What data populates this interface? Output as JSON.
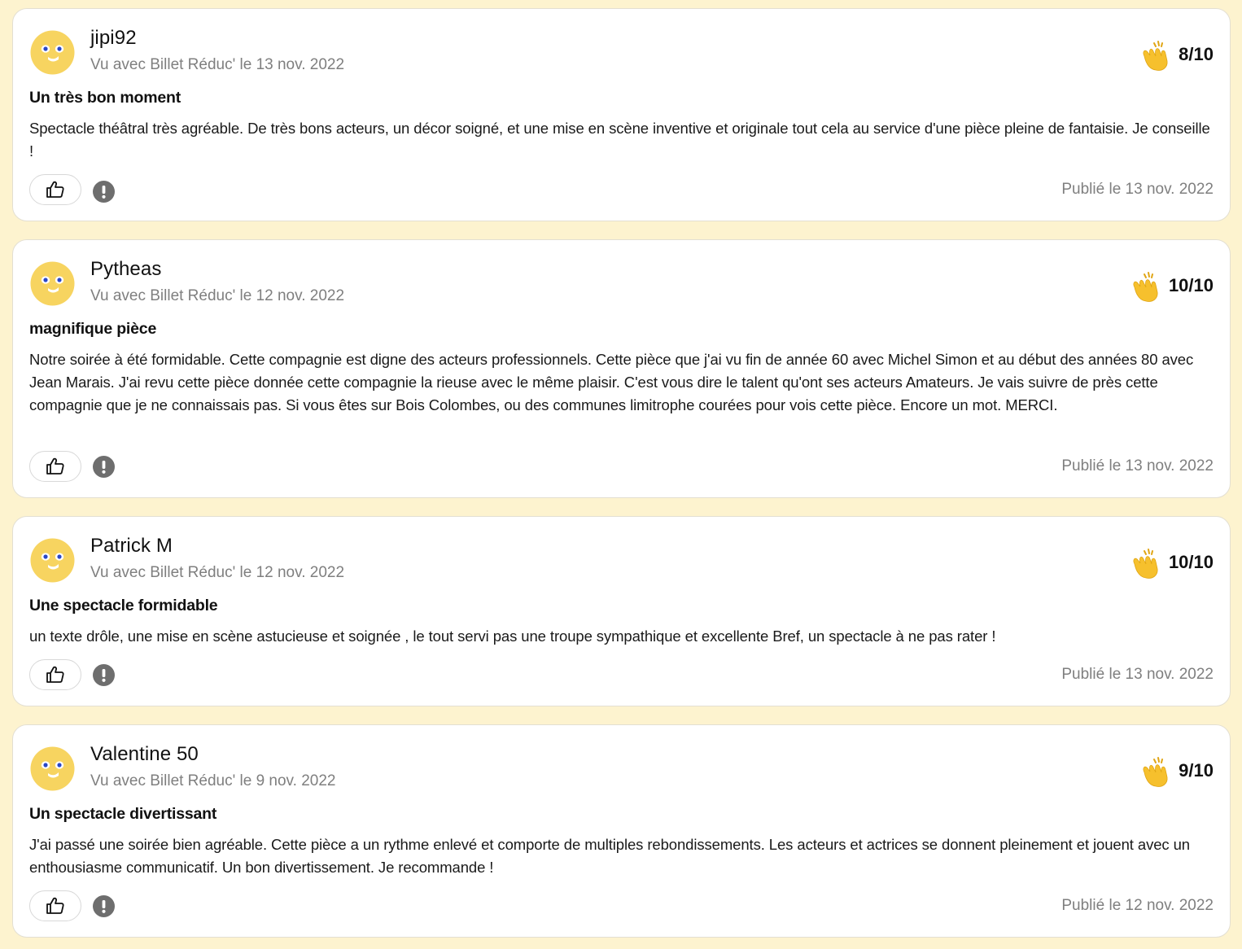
{
  "colors": {
    "page_background": "#fdf3cf",
    "card_background": "#ffffff",
    "avatar_yellow": "#f7d460",
    "muted_text": "#7f7f7f",
    "report_grey": "#6e6e6e"
  },
  "icons": {
    "avatar": "smiley-face-icon",
    "rating": "clapping-hands-icon",
    "like": "thumbs-up-icon",
    "report": "exclamation-icon"
  },
  "reviews": [
    {
      "author": "jipi92",
      "seen": "Vu avec Billet Réduc' le 13 nov. 2022",
      "score": "8/10",
      "title": "Un très bon moment",
      "body": "Spectacle théâtral très agréable. De très bons acteurs, un décor soigné, et une mise en scène inventive et originale tout cela au service d'une pièce pleine de fantaisie. Je conseille !",
      "published": "Publié le 13 nov. 2022"
    },
    {
      "author": "Pytheas",
      "seen": "Vu avec Billet Réduc' le 12 nov. 2022",
      "score": "10/10",
      "title": "magnifique pièce",
      "body": "Notre soirée à été formidable. Cette compagnie est digne des acteurs professionnels. Cette pièce que j'ai vu fin de année 60 avec Michel Simon et au début des années 80 avec Jean Marais. J'ai revu cette pièce donnée cette compagnie la rieuse avec le même plaisir. C'est vous dire le talent qu'ont ses acteurs Amateurs. Je vais suivre de près cette compagnie que je ne connaissais pas. Si vous êtes sur Bois Colombes, ou des communes limitrophe courées pour vois cette pièce. Encore un mot. MERCI.",
      "published": "Publié le 13 nov. 2022"
    },
    {
      "author": "Patrick M",
      "seen": "Vu avec Billet Réduc' le 12 nov. 2022",
      "score": "10/10",
      "title": "Une spectacle formidable",
      "body": "un texte drôle, une mise en scène astucieuse et soignée , le tout servi pas une troupe sympathique et excellente Bref, un spectacle à ne pas rater !",
      "published": "Publié le 13 nov. 2022"
    },
    {
      "author": "Valentine 50",
      "seen": "Vu avec Billet Réduc' le 9 nov. 2022",
      "score": "9/10",
      "title": "Un spectacle divertissant",
      "body": "J'ai passé une soirée bien agréable. Cette pièce a un rythme enlevé et comporte de multiples rebondissements. Les acteurs et actrices se donnent pleinement et jouent avec un enthousiasme communicatif. Un bon divertissement. Je recommande !",
      "published": "Publié le 12 nov. 2022"
    }
  ]
}
